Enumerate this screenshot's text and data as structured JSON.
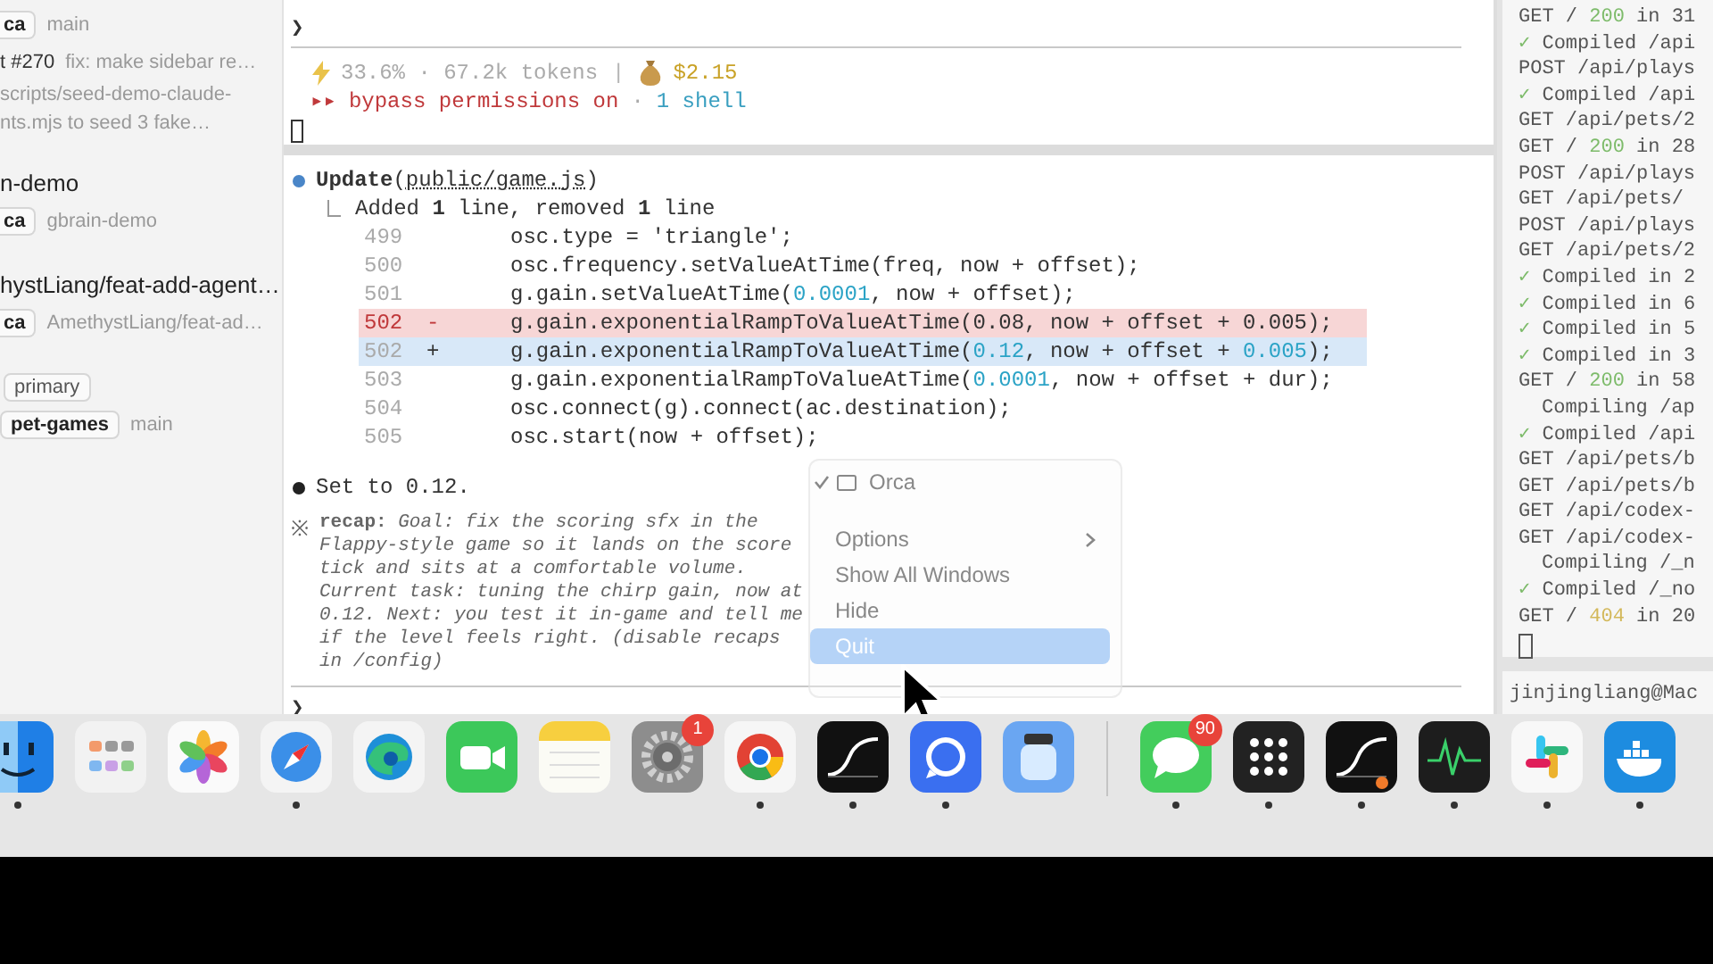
{
  "sidebar": {
    "rows": [
      {
        "kind": "badge-line",
        "badge": "ca",
        "text": "main"
      },
      {
        "kind": "pr-line",
        "number": "t #270",
        "text": "fix: make sidebar re…"
      },
      {
        "kind": "note",
        "text": "scripts/seed-demo-claude-"
      },
      {
        "kind": "note",
        "text": "nts.mjs to seed 3 fake…"
      },
      {
        "kind": "title",
        "text": "n-demo"
      },
      {
        "kind": "badge-line",
        "badge": "ca",
        "text": "gbrain-demo"
      },
      {
        "kind": "title",
        "text": "hystLiang/feat-add-agent…"
      },
      {
        "kind": "badge-line",
        "badge": "ca",
        "text": "AmethystLiang/feat-ad…"
      },
      {
        "kind": "tag",
        "badge": "primary"
      },
      {
        "kind": "repo-line",
        "badge": "pet-games",
        "text": "main"
      }
    ]
  },
  "terminal": {
    "prompt": "❯",
    "stats": {
      "usage": "33.6% · 67.2k tokens",
      "separator": "|",
      "cost": "$2.15"
    },
    "mode": {
      "arrows": "▸▸",
      "text": "bypass permissions on",
      "dot": "·",
      "shells": "1 shell"
    },
    "update": {
      "tool": "Update",
      "open": "(",
      "file": "public/game.js",
      "close": ")",
      "summary": "Added **1** line, removed **1** line",
      "lines": [
        {
          "number": "499",
          "kind": "context",
          "code": [
            {
              "text": "osc.type = 'triangle';",
              "kind": "plain"
            }
          ]
        },
        {
          "number": "500",
          "kind": "context",
          "code": [
            {
              "text": "osc.frequency.setValueAtTime(freq, now + offset);",
              "kind": "plain"
            }
          ]
        },
        {
          "number": "501",
          "kind": "context",
          "code": [
            {
              "text": "g.gain.setValueAtTime(",
              "kind": "plain"
            },
            {
              "text": "0.0001",
              "kind": "literal"
            },
            {
              "text": ", now + offset);",
              "kind": "plain"
            }
          ]
        },
        {
          "number": "502",
          "sign": "-",
          "kind": "removed",
          "code": [
            {
              "text": "g.gain.exponentialRampToValueAtTime(0.08, now + offset + 0.005);",
              "kind": "plain"
            }
          ]
        },
        {
          "number": "502",
          "sign": "+",
          "kind": "added",
          "code": [
            {
              "text": "g.gain.exponentialRampToValueAtTime(",
              "kind": "plain"
            },
            {
              "text": "0.12",
              "kind": "literal"
            },
            {
              "text": ", now + offset + ",
              "kind": "plain"
            },
            {
              "text": "0.005",
              "kind": "literal"
            },
            {
              "text": ");",
              "kind": "plain"
            }
          ]
        },
        {
          "number": "503",
          "kind": "context",
          "code": [
            {
              "text": "g.gain.exponentialRampToValueAtTime(",
              "kind": "plain"
            },
            {
              "text": "0.0001",
              "kind": "literal"
            },
            {
              "text": ", now + offset + dur);",
              "kind": "plain"
            }
          ]
        },
        {
          "number": "504",
          "kind": "context",
          "code": [
            {
              "text": "osc.connect(g).connect(ac.destination);",
              "kind": "plain"
            }
          ]
        },
        {
          "number": "505",
          "kind": "context",
          "code": [
            {
              "text": "osc.start(now + offset);",
              "kind": "plain"
            }
          ]
        }
      ]
    },
    "reply": "Set to 0.12.",
    "recap": {
      "symbol": "※",
      "text": "**recap:** *Goal: fix the scoring sfx in the Flappy-style game so it lands on the score tick and sits at a comfortable volume. Current task: tuning the chirp gain, now at 0.12. Next: you test it in-game and tell me if the level feels right. (disable recaps in /config)*"
    },
    "prompt2": "❯"
  },
  "menu": {
    "items": [
      {
        "label": "Orca",
        "kind": "window",
        "checked": true,
        "selected": false
      },
      {
        "label": "Options",
        "kind": "submenu",
        "checked": false,
        "selected": false
      },
      {
        "label": "Show All Windows",
        "kind": "plain",
        "checked": false,
        "selected": false
      },
      {
        "label": "Hide",
        "kind": "plain",
        "checked": false,
        "selected": false
      },
      {
        "label": "Quit",
        "kind": "plain",
        "checked": false,
        "selected": true
      }
    ]
  },
  "log": {
    "lines": [
      {
        "kind": "status",
        "text": "GET /",
        "status": "200",
        "color": "#7dbb6a",
        "tail": "in 31"
      },
      {
        "kind": "compiled",
        "check": "✓",
        "text": "Compiled /api"
      },
      {
        "kind": "plain",
        "text": "POST /api/plays"
      },
      {
        "kind": "compiled",
        "check": "✓",
        "text": "Compiled /api"
      },
      {
        "kind": "plain",
        "text": "GET /api/pets/2"
      },
      {
        "kind": "status",
        "text": "GET /",
        "status": "200",
        "color": "#7dbb6a",
        "tail": "in 28"
      },
      {
        "kind": "plain",
        "text": "POST /api/plays"
      },
      {
        "kind": "plain",
        "text": "GET /api/pets/"
      },
      {
        "kind": "plain",
        "text": "POST /api/plays"
      },
      {
        "kind": "plain",
        "text": "GET /api/pets/2"
      },
      {
        "kind": "compiled",
        "check": "✓",
        "text": "Compiled in 2"
      },
      {
        "kind": "compiled",
        "check": "✓",
        "text": "Compiled in 6"
      },
      {
        "kind": "compiled",
        "check": "✓",
        "text": "Compiled in 5"
      },
      {
        "kind": "compiled",
        "check": "✓",
        "text": "Compiled in 3"
      },
      {
        "kind": "status",
        "text": "GET /",
        "status": "200",
        "color": "#7dbb6a",
        "tail": "in 58"
      },
      {
        "kind": "compiling",
        "text": "Compiling /ap"
      },
      {
        "kind": "compiled",
        "check": "✓",
        "text": "Compiled /api"
      },
      {
        "kind": "plain",
        "text": "GET /api/pets/b"
      },
      {
        "kind": "plain",
        "text": "GET /api/pets/b"
      },
      {
        "kind": "plain",
        "text": "GET /api/codex-"
      },
      {
        "kind": "plain",
        "text": "GET /api/codex-"
      },
      {
        "kind": "compiling",
        "text": "Compiling /_n"
      },
      {
        "kind": "compiled",
        "check": "✓",
        "text": "Compiled /_no"
      },
      {
        "kind": "status",
        "text": "GET /",
        "status": "404",
        "color": "#d3b85a",
        "tail": "in 20"
      }
    ],
    "shell": "jinjingliang@Mac"
  },
  "dock": {
    "apps": [
      {
        "kind": "finder",
        "running": true
      },
      {
        "kind": "launchpad",
        "running": false
      },
      {
        "kind": "photos",
        "running": false
      },
      {
        "kind": "compass",
        "running": true
      },
      {
        "kind": "swirl",
        "running": false
      },
      {
        "kind": "camera",
        "running": false
      },
      {
        "kind": "notes",
        "running": false
      },
      {
        "kind": "gear",
        "running": false,
        "badge": "1"
      },
      {
        "kind": "ring",
        "running": true
      },
      {
        "kind": "curve",
        "running": true
      },
      {
        "kind": "speech",
        "running": true
      },
      {
        "kind": "jar",
        "running": false
      },
      {
        "kind": "divider"
      },
      {
        "kind": "chat",
        "running": true,
        "badge": "90"
      },
      {
        "kind": "dots",
        "running": true
      },
      {
        "kind": "curve",
        "running": true,
        "alert": true
      },
      {
        "kind": "pulse",
        "running": true
      },
      {
        "kind": "hash",
        "running": true
      },
      {
        "kind": "whale",
        "running": true
      }
    ]
  }
}
